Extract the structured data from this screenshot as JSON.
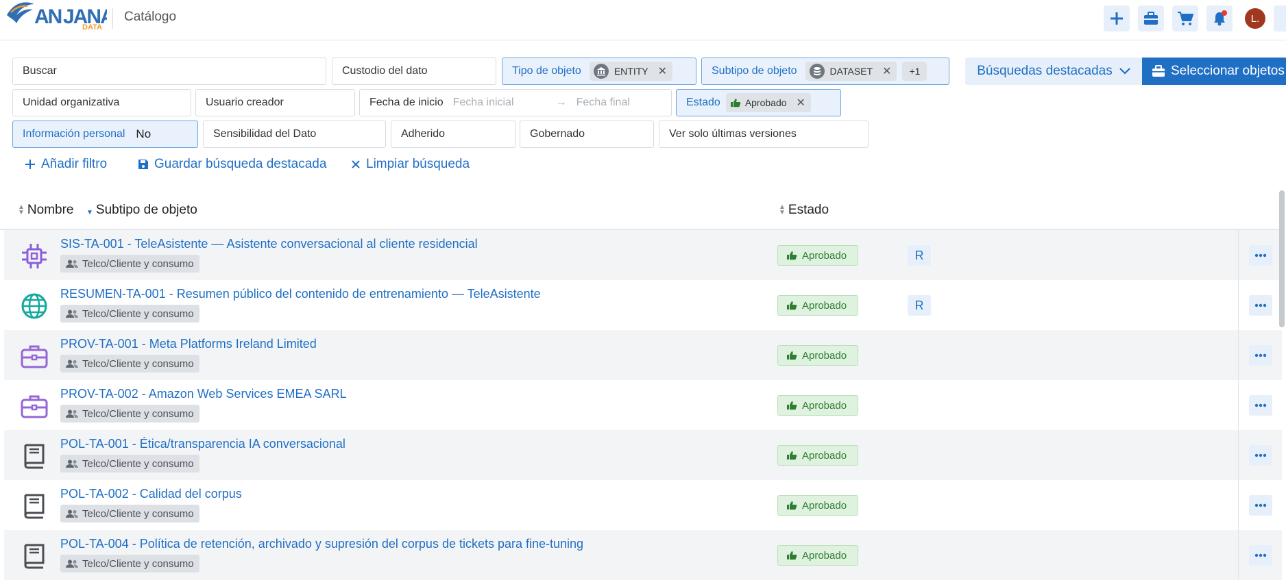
{
  "header": {
    "logo_text": "ANJANA",
    "logo_sub": "DATA",
    "title": "Catálogo",
    "avatar_initial": "L."
  },
  "filters": {
    "search": "Buscar",
    "custodian": "Custodio del dato",
    "object_type": {
      "label": "Tipo de objeto",
      "value": "ENTITY"
    },
    "object_subtype": {
      "label": "Subtipo de objeto",
      "value": "DATASET",
      "extra": "+1"
    },
    "org_unit": "Unidad organizativa",
    "creator": "Usuario creador",
    "start_date": {
      "label": "Fecha de inicio",
      "from_placeholder": "Fecha inicial",
      "to_placeholder": "Fecha final"
    },
    "status": {
      "label": "Estado",
      "value": "Aprobado"
    },
    "personal_info": {
      "label": "Información personal",
      "value": "No"
    },
    "sensitivity": "Sensibilidad del Dato",
    "adhered": "Adherido",
    "governed": "Gobernado",
    "latest_only": "Ver solo últimas versiones",
    "featured_button": "Búsquedas destacadas",
    "select_button": "Seleccionar objetos"
  },
  "actions": {
    "add_filter": "Añadir filtro",
    "save_search": "Guardar búsqueda destacada",
    "clear_search": "Limpiar búsqueda"
  },
  "table": {
    "columns": {
      "name": "Nombre",
      "subtype": "Subtipo de objeto",
      "status": "Estado"
    },
    "rows": [
      {
        "icon": "chip-icon",
        "name": "SIS-TA-001 - TeleAsistente — Asistente conversacional al cliente residencial",
        "domain": "Telco/Cliente y consumo",
        "status": "Aprobado",
        "badge": "R"
      },
      {
        "icon": "globe-icon",
        "name": "RESUMEN-TA-001 - Resumen público del contenido de entrenamiento — TeleAsistente",
        "domain": "Telco/Cliente y consumo",
        "status": "Aprobado",
        "badge": "R"
      },
      {
        "icon": "briefcase-icon",
        "name": "PROV-TA-001 - Meta Platforms Ireland Limited",
        "domain": "Telco/Cliente y consumo",
        "status": "Aprobado",
        "badge": ""
      },
      {
        "icon": "briefcase-icon",
        "name": "PROV-TA-002 - Amazon Web Services EMEA SARL",
        "domain": "Telco/Cliente y consumo",
        "status": "Aprobado",
        "badge": ""
      },
      {
        "icon": "book-icon",
        "name": " POL-TA-001 - Ética/transparencia IA conversacional",
        "domain": "Telco/Cliente y consumo",
        "status": "Aprobado",
        "badge": ""
      },
      {
        "icon": "book-icon",
        "name": "POL-TA-002 - Calidad del corpus",
        "domain": "Telco/Cliente y consumo",
        "status": "Aprobado",
        "badge": ""
      },
      {
        "icon": "book-icon",
        "name": "POL-TA-004 - Política de retención, archivado y supresión del corpus de tickets para fine-tuning",
        "domain": "Telco/Cliente y consumo",
        "status": "Aprobado",
        "badge": ""
      }
    ]
  },
  "colors": {
    "accent": "#1f6fc5",
    "approved_bg": "#dff2df",
    "approved_text": "#2e7d32"
  }
}
